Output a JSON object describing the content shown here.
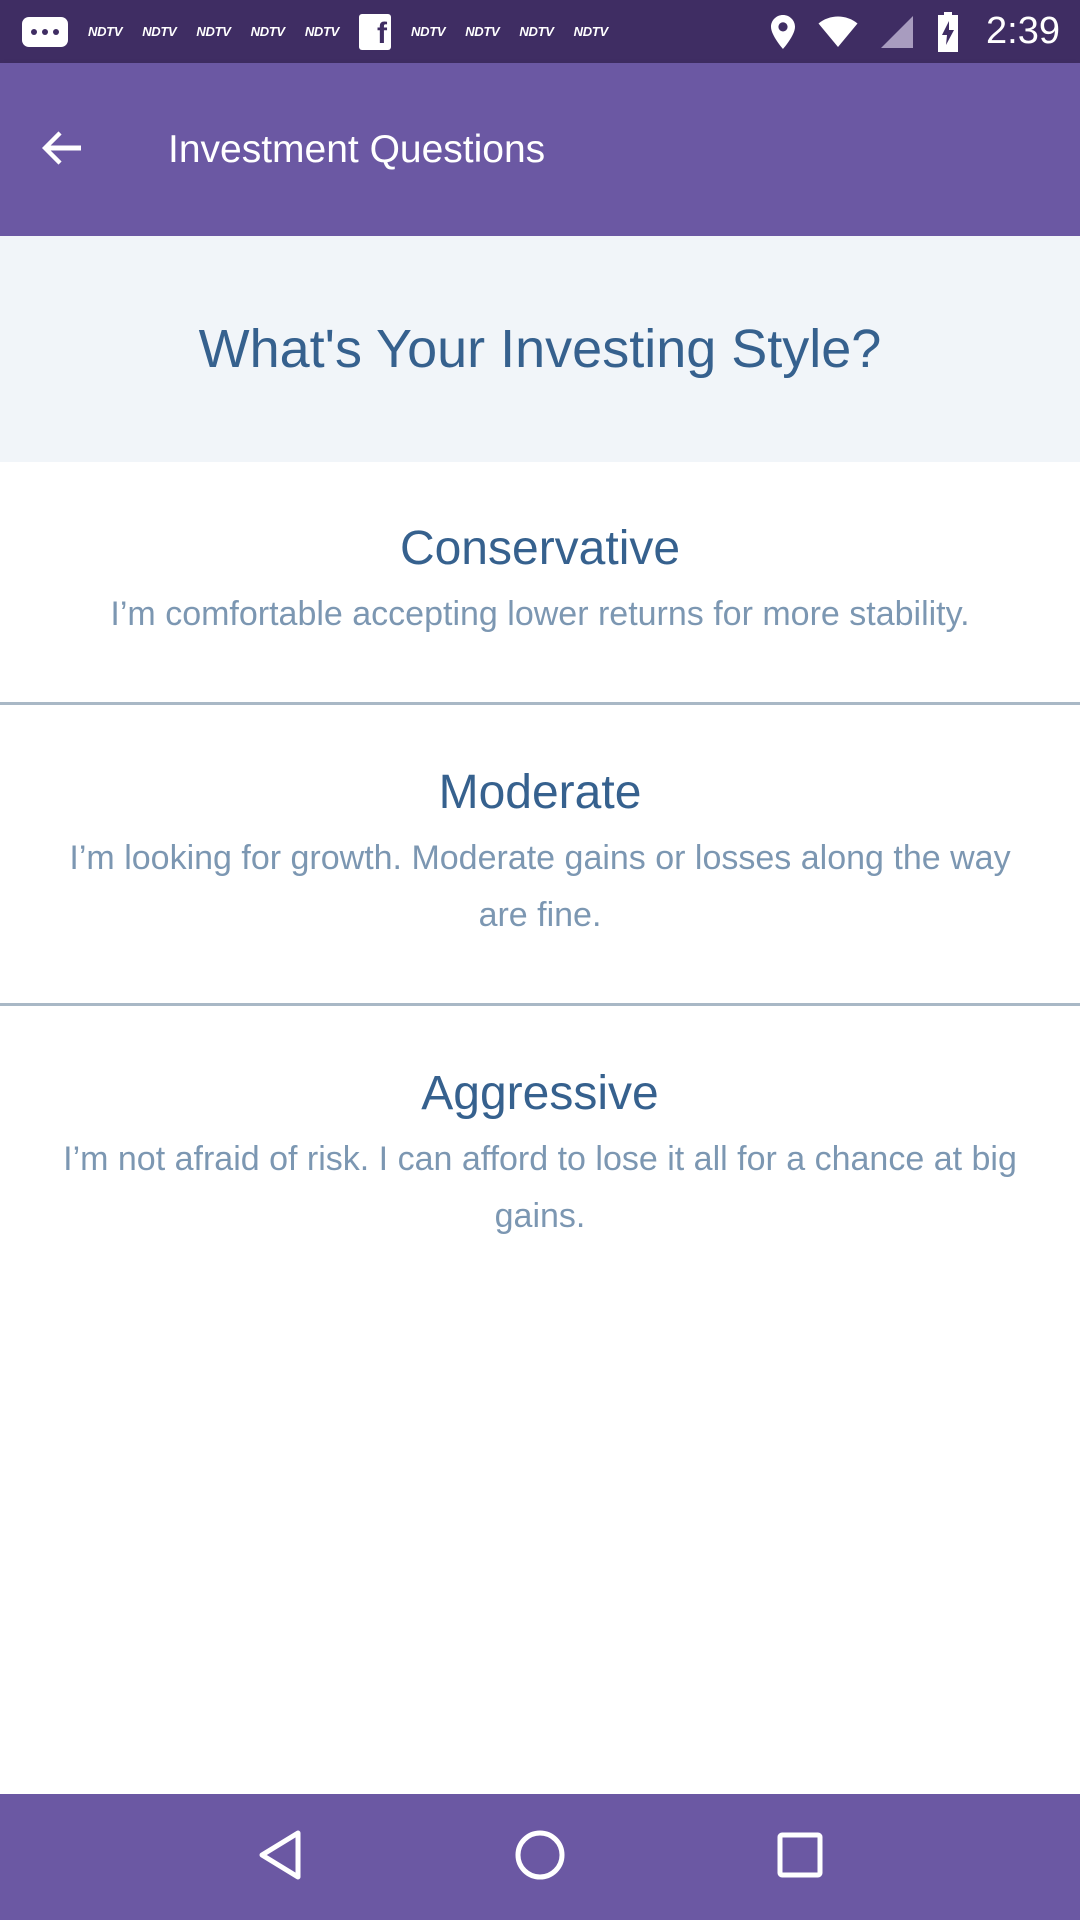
{
  "status_bar": {
    "time": "2:39",
    "notification_icons": [
      "message-icon",
      "ndtv-icon",
      "ndtv-icon",
      "ndtv-icon",
      "ndtv-icon",
      "ndtv-icon",
      "facebook-icon",
      "ndtv-icon",
      "ndtv-icon",
      "ndtv-icon",
      "ndtv-icon"
    ],
    "ndtv_label": "NDTV",
    "facebook_label": "f",
    "system_icons": [
      "location-icon",
      "wifi-icon",
      "cellular-signal-icon",
      "battery-charging-icon"
    ]
  },
  "app_bar": {
    "title": "Investment Questions",
    "back_icon": "arrow-back-icon"
  },
  "question": {
    "title": "What's Your Investing Style?"
  },
  "options": [
    {
      "title": "Conservative",
      "description": "I’m comfortable accepting lower returns for more stability."
    },
    {
      "title": "Moderate",
      "description": "I’m looking for growth. Moderate gains or losses along the way are fine."
    },
    {
      "title": "Aggressive",
      "description": "I’m not afraid of risk. I can afford to lose it all for a chance at big gains."
    }
  ],
  "nav_bar": {
    "icons": [
      "back-triangle-icon",
      "home-circle-icon",
      "recents-square-icon"
    ]
  },
  "colors": {
    "status_bar": "#3f2d63",
    "app_bar": "#6b58a3",
    "header_bg": "#f1f5f9",
    "title_text": "#36618e",
    "desc_text": "#7c97b2",
    "divider": "#a9b8c6"
  }
}
